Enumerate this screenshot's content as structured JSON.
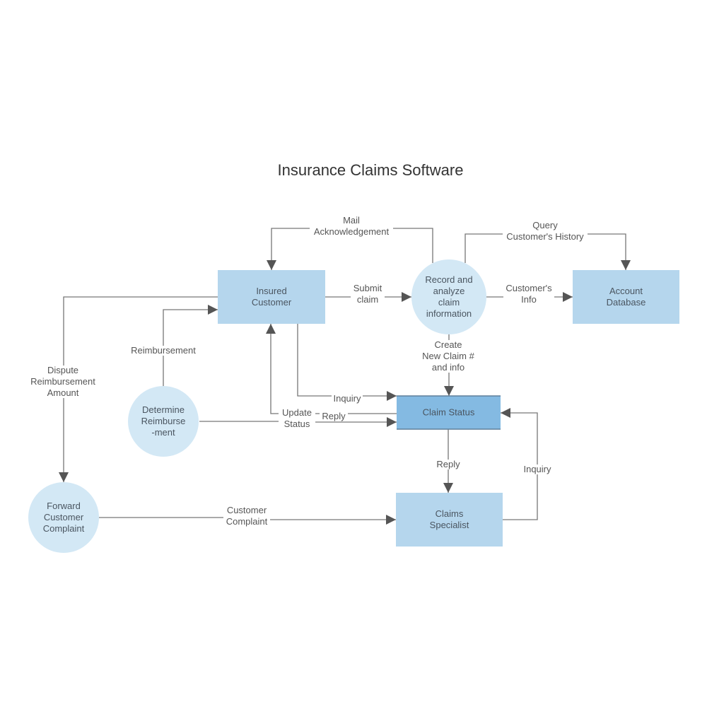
{
  "diagram": {
    "title": "Insurance Claims Software",
    "colors": {
      "box_fill": "#b5d6ed",
      "highlight_box_fill": "#84bae2",
      "highlight_box_border": "#5f7f9a",
      "circle_fill": "#d3e8f5",
      "edge": "#777777",
      "arrow": "#555555"
    },
    "nodes": [
      {
        "id": "insured_customer",
        "shape": "rect",
        "label": [
          "Insured",
          "Customer"
        ]
      },
      {
        "id": "record_analyze",
        "shape": "circle",
        "label": [
          "Record and",
          "analyze",
          "claim",
          "information"
        ]
      },
      {
        "id": "account_database",
        "shape": "rect",
        "label": [
          "Account",
          "Database"
        ]
      },
      {
        "id": "claim_status",
        "shape": "rect-highlight",
        "label": [
          "Claim Status"
        ]
      },
      {
        "id": "determine_reimbursement",
        "shape": "circle",
        "label": [
          "Determine",
          "Reimburse",
          "-ment"
        ]
      },
      {
        "id": "forward_complaint",
        "shape": "circle",
        "label": [
          "Forward",
          "Customer",
          "Complaint"
        ]
      },
      {
        "id": "claims_specialist",
        "shape": "rect",
        "label": [
          "Claims",
          "Specialist"
        ]
      }
    ],
    "edges": [
      {
        "id": "mail_ack",
        "from": "record_analyze",
        "to": "insured_customer",
        "label": [
          "Mail",
          "Acknowledgement"
        ]
      },
      {
        "id": "submit_claim",
        "from": "insured_customer",
        "to": "record_analyze",
        "label": [
          "Submit",
          "claim"
        ]
      },
      {
        "id": "query_history",
        "from": "record_analyze",
        "to": "account_database",
        "label": [
          "Query",
          "Customer's History"
        ]
      },
      {
        "id": "customers_info",
        "from": "record_analyze",
        "to": "account_database",
        "label": [
          "Customer's",
          "Info"
        ]
      },
      {
        "id": "create_claim",
        "from": "record_analyze",
        "to": "claim_status",
        "label": [
          "Create",
          "New Claim #",
          "and info"
        ]
      },
      {
        "id": "inquiry_customer",
        "from": "insured_customer",
        "to": "claim_status",
        "label": [
          "Inquiry"
        ]
      },
      {
        "id": "reply_customer",
        "from": "claim_status",
        "to": "insured_customer",
        "label": [
          "Reply"
        ]
      },
      {
        "id": "update_status",
        "from": "determine_reimbursement",
        "to": "claim_status",
        "label": [
          "Update",
          "Status"
        ]
      },
      {
        "id": "reimbursement",
        "from": "determine_reimbursement",
        "to": "insured_customer",
        "label": [
          "Reimbursement"
        ]
      },
      {
        "id": "dispute",
        "from": "insured_customer",
        "to": "forward_complaint",
        "label": [
          "Dispute",
          "Reimbursement",
          "Amount"
        ]
      },
      {
        "id": "customer_complaint",
        "from": "forward_complaint",
        "to": "claims_specialist",
        "label": [
          "Customer",
          "Complaint"
        ]
      },
      {
        "id": "reply_specialist",
        "from": "claim_status",
        "to": "claims_specialist",
        "label": [
          "Reply"
        ]
      },
      {
        "id": "inquiry_specialist",
        "from": "claims_specialist",
        "to": "claim_status",
        "label": [
          "Inquiry"
        ]
      }
    ]
  }
}
